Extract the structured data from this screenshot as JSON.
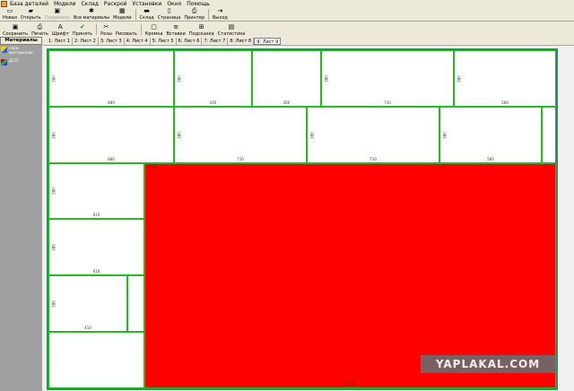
{
  "menu": [
    "База деталей",
    "Модели",
    "Склад",
    "Раскрой",
    "Установки",
    "Окно",
    "Помощь"
  ],
  "toolbar_top": [
    {
      "label": "Новая",
      "icon": "new-doc-icon",
      "glyph": "▭",
      "disabled": false
    },
    {
      "label": "Открыть",
      "icon": "open-folder-icon",
      "glyph": "▰",
      "disabled": false
    },
    {
      "label": "Сохранить",
      "icon": "save-icon",
      "glyph": "▣",
      "disabled": true
    },
    {
      "label": "Все материалы",
      "icon": "all-materials-icon",
      "glyph": "✱",
      "disabled": false
    },
    {
      "label": "Модели",
      "icon": "models-icon",
      "glyph": "▦",
      "disabled": false
    },
    {
      "label": "Склад",
      "icon": "warehouse-icon",
      "glyph": "▬",
      "disabled": false
    },
    {
      "label": "Страница",
      "icon": "page-icon",
      "glyph": "▯",
      "disabled": false
    },
    {
      "label": "Принтер",
      "icon": "printer-icon",
      "glyph": "⎙",
      "disabled": false
    },
    {
      "label": "Выход",
      "icon": "exit-icon",
      "glyph": "⇥",
      "disabled": false
    }
  ],
  "toolbar_bottom": [
    {
      "label": "Сохранить",
      "icon": "save-icon",
      "glyph": "▣"
    },
    {
      "label": "Печать",
      "icon": "print-icon",
      "glyph": "⎙"
    },
    {
      "label": "Шрифт",
      "icon": "font-icon",
      "glyph": "A"
    },
    {
      "label": "Принять",
      "icon": "accept-check-icon",
      "glyph": "✔"
    },
    {
      "label": "Резы",
      "icon": "cuts-icon",
      "glyph": "✂"
    },
    {
      "label": "Рисовать",
      "icon": "draw-icon",
      "glyph": ""
    },
    {
      "label": "Кромка",
      "icon": "edge-icon",
      "glyph": "▢"
    },
    {
      "label": "Вставки",
      "icon": "inserts-icon",
      "glyph": "≡"
    },
    {
      "label": "Подсказка",
      "icon": "hint-icon",
      "glyph": "⊞"
    },
    {
      "label": "Статистика",
      "icon": "statistics-icon",
      "glyph": "▤"
    }
  ],
  "sheet_tabs": [
    "1: Лист 1",
    "2: Лист 2",
    "3: Лист 3",
    "4: Лист 4",
    "5: Лист 5",
    "6: Лист 6",
    "7: Лист 7",
    "8: Лист 8",
    "9: Лист 9"
  ],
  "active_tab_index": 8,
  "sidebar": {
    "header": "Материалы",
    "items": [
      {
        "label": "свои материалы"
      },
      {
        "label": "ДСП"
      }
    ]
  },
  "parts": [
    {
      "w": "880",
      "h": "380"
    },
    {
      "w": "410",
      "h": "380"
    },
    {
      "w": "360",
      "h": ""
    },
    {
      "w": "710",
      "h": "380"
    },
    {
      "w": "560",
      "h": "380"
    },
    {
      "w": "880",
      "h": "380"
    },
    {
      "w": "710",
      "h": "380"
    },
    {
      "w": "710",
      "h": "380"
    },
    {
      "w": "560",
      "h": "380"
    },
    {
      "w": "",
      "h": ""
    },
    {
      "w": "610",
      "h": "380"
    },
    {
      "w": "610",
      "h": "380"
    },
    {
      "w": "410",
      "h": "380"
    },
    {
      "w": "",
      "h": ""
    },
    {
      "w": "",
      "h": ""
    }
  ],
  "offcut": {
    "w": "2220",
    "tag": "2220x..."
  },
  "watermark": "YAPLAKAL.COM",
  "colors": {
    "offcut": "#ff0000",
    "part_border": "#22bb22",
    "sheet_border": "#2e8b57",
    "sidebar_bg": "#a0a0a0",
    "chrome": "#ece9d8"
  }
}
